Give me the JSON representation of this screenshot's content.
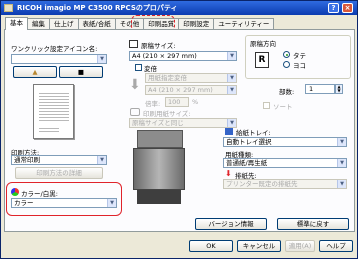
{
  "window": {
    "title": "RICOH imagio MP C3500 RPCSのプロパティ"
  },
  "title_buttons": {
    "help": "?",
    "close": "×"
  },
  "tabs": [
    "基本",
    "編集",
    "仕上げ",
    "表紙/合紙",
    "その他",
    "印刷品質",
    "印刷設定",
    "ユーティリティー"
  ],
  "one_click": {
    "label": "ワンクリック設定アイコン名:",
    "value": ""
  },
  "print_method": {
    "label": "印刷方法:",
    "value": "通常印刷",
    "details_button": "印刷方法の詳細"
  },
  "color_mode": {
    "label": "カラー/白黒:",
    "value": "カラー"
  },
  "paper_size": {
    "label": "原稿サイズ:",
    "value": "A4 (210 × 297 mm)"
  },
  "scale": {
    "label": "変倍",
    "mode_value": "用紙指定変倍",
    "paper_value": "A4 (210 × 297 mm)",
    "percent_label": "倍率:",
    "percent_value": "100",
    "unit": "%"
  },
  "print_paper_size": {
    "label": "印刷用紙サイズ:",
    "value": "原稿サイズと同じ"
  },
  "orientation": {
    "label": "原稿方向",
    "options": [
      "タテ",
      "ヨコ"
    ],
    "selected": "タテ"
  },
  "copies": {
    "label": "部数:",
    "value": "1"
  },
  "sort": {
    "label": "ソート"
  },
  "paper_tray": {
    "label": "給紙トレイ:",
    "value": "自動トレイ選択"
  },
  "paper_type": {
    "label": "用紙種類:",
    "value": "普通紙/再生紙"
  },
  "output_tray": {
    "label": "排紙先:",
    "value": "プリンター既定の排紙先"
  },
  "version_button": "バージョン情報",
  "restore_button": "標準に戻す",
  "footer": {
    "ok": "OK",
    "cancel": "キャンセル",
    "apply": "適用(A)",
    "help": "ヘルプ"
  },
  "colors": {
    "accent_red": "#e0242b",
    "title_blue": "#0b3bb0"
  }
}
